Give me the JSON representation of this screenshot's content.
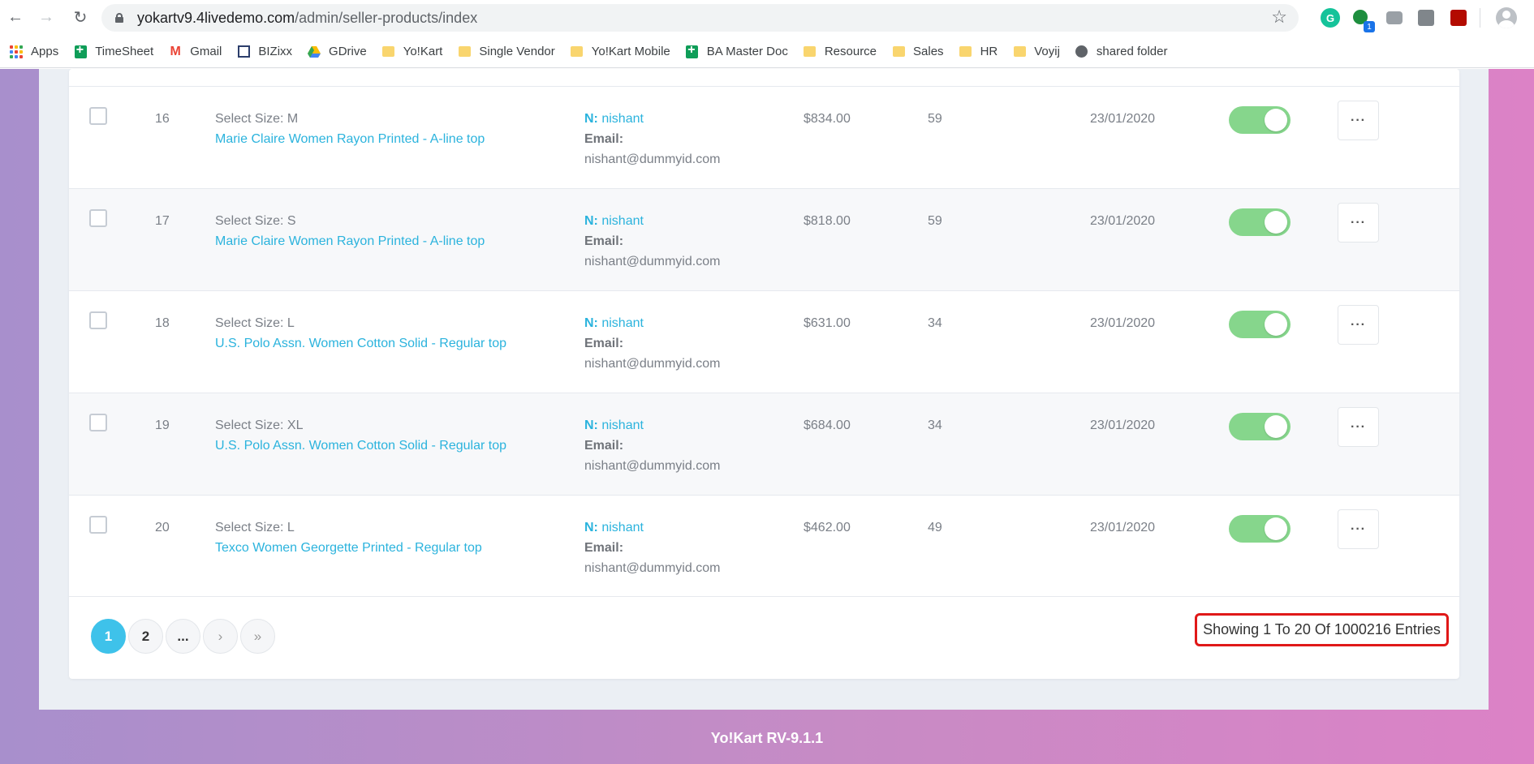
{
  "browser": {
    "url_host": "yokartv9.4livedemo.com",
    "url_path": "/admin/seller-products/index",
    "extension_badge": "1",
    "bookmarks": [
      {
        "label": "Apps",
        "icon": "apps-grid-icon"
      },
      {
        "label": "TimeSheet",
        "icon": "sheets-icon"
      },
      {
        "label": "Gmail",
        "icon": "gmail-icon"
      },
      {
        "label": "BIZixx",
        "icon": "bizixx-icon"
      },
      {
        "label": "GDrive",
        "icon": "gdrive-icon"
      },
      {
        "label": "Yo!Kart",
        "icon": "folder-icon"
      },
      {
        "label": "Single Vendor",
        "icon": "folder-icon"
      },
      {
        "label": "Yo!Kart Mobile",
        "icon": "folder-icon"
      },
      {
        "label": "BA Master Doc",
        "icon": "sheets-icon"
      },
      {
        "label": "Resource",
        "icon": "folder-icon"
      },
      {
        "label": "Sales",
        "icon": "folder-icon"
      },
      {
        "label": "HR",
        "icon": "folder-icon"
      },
      {
        "label": "Voyij",
        "icon": "folder-icon"
      },
      {
        "label": "shared folder",
        "icon": "globe-icon"
      }
    ]
  },
  "table": {
    "rows": [
      {
        "sno": "16",
        "size": "Select Size: M",
        "product": "Marie Claire Women Rayon Printed - A-line top",
        "seller_prefix": "N:",
        "seller_name": "nishant",
        "email_label": "Email:",
        "email": "nishant@dummyid.com",
        "price": "$834.00",
        "stock": "59",
        "date": "23/01/2020",
        "status_on": true
      },
      {
        "sno": "17",
        "size": "Select Size: S",
        "product": "Marie Claire Women Rayon Printed - A-line top",
        "seller_prefix": "N:",
        "seller_name": "nishant",
        "email_label": "Email:",
        "email": "nishant@dummyid.com",
        "price": "$818.00",
        "stock": "59",
        "date": "23/01/2020",
        "status_on": true
      },
      {
        "sno": "18",
        "size": "Select Size: L",
        "product": "U.S. Polo Assn. Women Cotton Solid - Regular top",
        "seller_prefix": "N:",
        "seller_name": "nishant",
        "email_label": "Email:",
        "email": "nishant@dummyid.com",
        "price": "$631.00",
        "stock": "34",
        "date": "23/01/2020",
        "status_on": true
      },
      {
        "sno": "19",
        "size": "Select Size: XL",
        "product": "U.S. Polo Assn. Women Cotton Solid - Regular top",
        "seller_prefix": "N:",
        "seller_name": "nishant",
        "email_label": "Email:",
        "email": "nishant@dummyid.com",
        "price": "$684.00",
        "stock": "34",
        "date": "23/01/2020",
        "status_on": true
      },
      {
        "sno": "20",
        "size": "Select Size: L",
        "product": "Texco Women Georgette Printed - Regular top",
        "seller_prefix": "N:",
        "seller_name": "nishant",
        "email_label": "Email:",
        "email": "nishant@dummyid.com",
        "price": "$462.00",
        "stock": "49",
        "date": "23/01/2020",
        "status_on": true
      }
    ],
    "actions_label": "···"
  },
  "pagination": {
    "pages": [
      "1",
      "2",
      "..."
    ],
    "active": "1",
    "next": "›",
    "last": "»",
    "summary": "Showing 1 To 20 Of 1000216 Entries"
  },
  "footer": {
    "text": "Yo!Kart RV-9.1.1"
  },
  "colors": {
    "accent": "#3ec2ea",
    "link": "#2bb3dd",
    "toggle_on": "#86d68c",
    "highlight_box": "#e01818"
  }
}
